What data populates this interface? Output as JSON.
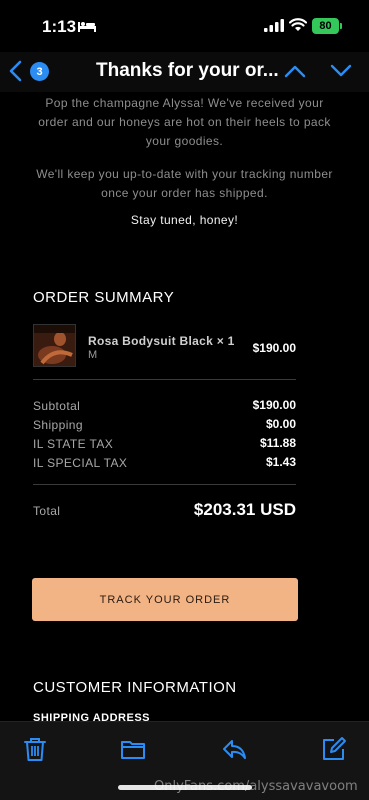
{
  "status_bar": {
    "time": "1:13",
    "battery": "80"
  },
  "nav": {
    "badge_count": "3",
    "title": "Thanks for your or..."
  },
  "email": {
    "intro_1": "Pop the champagne Alyssa! We've received your order and our honeys are hot on their heels to pack your goodies.",
    "intro_2": "We'll keep you up-to-date with your tracking number once your order has shipped.",
    "stay_tuned": "Stay tuned, honey!",
    "order_summary_title": "ORDER SUMMARY",
    "item": {
      "name": "Rosa Bodysuit Black × 1",
      "variant": "M",
      "price": "$190.00"
    },
    "totals": [
      {
        "label": "Subtotal",
        "value": "$190.00"
      },
      {
        "label": "Shipping",
        "value": "$0.00"
      },
      {
        "label": "IL STATE TAX",
        "value": "$11.88"
      },
      {
        "label": "IL SPECIAL TAX",
        "value": "$1.43"
      }
    ],
    "total_label": "Total",
    "total_value": "$203.31 USD",
    "track_button": "TRACK YOUR ORDER",
    "customer_info_title": "CUSTOMER INFORMATION",
    "shipping_address_title": "SHIPPING ADDRESS"
  },
  "watermark": "OnlyFans.com/alyssavavavoom",
  "colors": {
    "accent": "#2b8cf3",
    "button": "#f2b485",
    "background": "#000000"
  }
}
